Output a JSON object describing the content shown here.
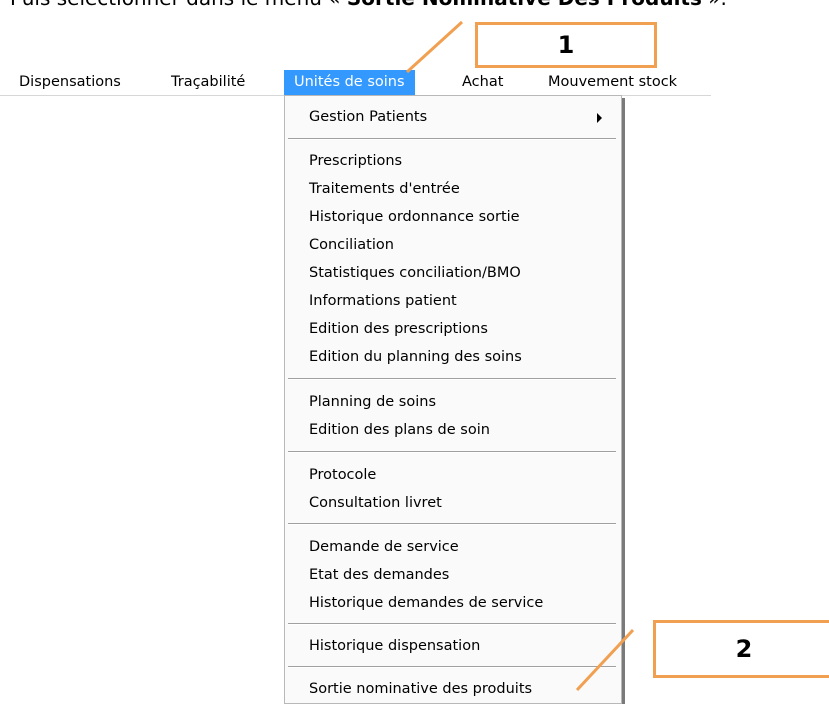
{
  "caption": {
    "prefix": "Puis sélectionner dans le menu « ",
    "bold": "Sortie Nominative Des Produits",
    "suffix": " »."
  },
  "menubar": {
    "items": [
      {
        "label": "Dispensations"
      },
      {
        "label": "Traçabilité"
      },
      {
        "label": "Unités de soins",
        "active": true
      },
      {
        "label": "Achat"
      },
      {
        "label": "Mouvement stock"
      }
    ]
  },
  "dropdown": {
    "groups": [
      [
        "Gestion Patients"
      ],
      [
        "Prescriptions",
        "Traitements d'entrée",
        "Historique ordonnance sortie",
        "Conciliation",
        "Statistiques conciliation/BMO",
        "Informations patient",
        "Edition des prescriptions",
        "Edition du planning des soins"
      ],
      [
        "Planning de soins",
        "Edition des plans de soin"
      ],
      [
        "Protocole",
        "Consultation livret"
      ],
      [
        "Demande de service",
        "Etat des demandes",
        "Historique demandes de service"
      ],
      [
        "Historique dispensation"
      ],
      [
        "Sortie nominative des produits"
      ]
    ]
  },
  "callouts": [
    {
      "label": "1"
    },
    {
      "label": "2"
    }
  ],
  "colors": {
    "active_menu": "#3399ff",
    "callout_orange": "#f0a050"
  }
}
